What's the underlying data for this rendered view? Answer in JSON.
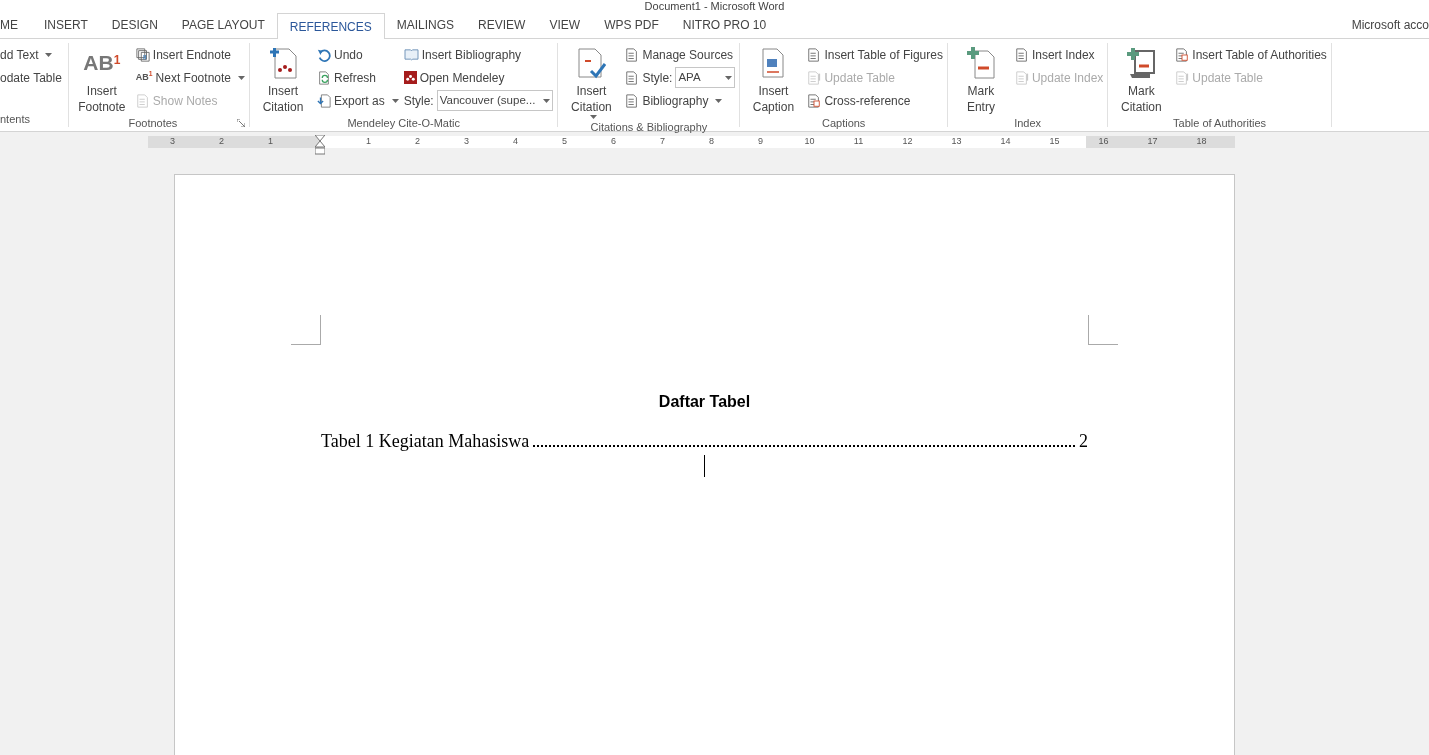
{
  "window": {
    "title": "Document1 - Microsoft Word"
  },
  "tabs": [
    {
      "label": "ME",
      "selected": false
    },
    {
      "label": "INSERT",
      "selected": false
    },
    {
      "label": "DESIGN",
      "selected": false
    },
    {
      "label": "PAGE LAYOUT",
      "selected": false
    },
    {
      "label": "REFERENCES",
      "selected": true
    },
    {
      "label": "MAILINGS",
      "selected": false
    },
    {
      "label": "REVIEW",
      "selected": false
    },
    {
      "label": "VIEW",
      "selected": false
    },
    {
      "label": "WPS PDF",
      "selected": false
    },
    {
      "label": "NITRO PRO 10",
      "selected": false
    }
  ],
  "account": "Microsoft acco",
  "groups": [
    {
      "label": "ntents",
      "columns": [
        [
          {
            "kind": "small",
            "label": "dd Text",
            "dropdown": true,
            "disabled": false
          },
          {
            "kind": "small",
            "label": "odate Table",
            "disabled": false
          }
        ]
      ]
    },
    {
      "label": "Footnotes",
      "launcher": true,
      "columns": [
        [
          {
            "kind": "large",
            "label": "Insert Footnote",
            "glyph": "AB$^{1}$",
            "disabled": false
          }
        ],
        [
          {
            "kind": "small",
            "label": "Insert Endnote",
            "disabled": false
          },
          {
            "kind": "small",
            "label": "Next Footnote",
            "glyph": "AB$^{1}$",
            "dropdown": true,
            "disabled": false
          },
          {
            "kind": "small",
            "label": "Show Notes",
            "disabled": true
          }
        ]
      ]
    },
    {
      "label": "Mendeley Cite-O-Matic",
      "columns": [
        [
          {
            "kind": "large",
            "label": "Insert Citation",
            "disabled": false
          }
        ],
        [
          {
            "kind": "small",
            "label": "Undo",
            "disabled": false
          },
          {
            "kind": "small",
            "label": "Refresh",
            "disabled": false
          },
          {
            "kind": "small",
            "label": "Export as",
            "dropdown": true,
            "disabled": false
          }
        ],
        [
          {
            "kind": "small",
            "label": "Insert Bibliography",
            "disabled": false
          },
          {
            "kind": "small",
            "label": "Open Mendeley",
            "disabled": false
          },
          {
            "kind": "select",
            "label": "Style:",
            "value": "Vancouver (supe..."
          }
        ]
      ]
    },
    {
      "label": "Citations & Bibliography",
      "columns": [
        [
          {
            "kind": "large",
            "label": "Insert Citation",
            "dropdown": true,
            "disabled": false
          }
        ],
        [
          {
            "kind": "small",
            "label": "Manage Sources",
            "disabled": false
          },
          {
            "kind": "select",
            "label": "Style:",
            "value": "APA"
          },
          {
            "kind": "small",
            "label": "Bibliography",
            "dropdown": true,
            "disabled": false
          }
        ]
      ]
    },
    {
      "label": "Captions",
      "columns": [
        [
          {
            "kind": "large",
            "label": "Insert Caption",
            "disabled": false
          }
        ],
        [
          {
            "kind": "small",
            "label": "Insert Table of Figures",
            "disabled": false
          },
          {
            "kind": "small",
            "label": "Update Table",
            "disabled": true
          },
          {
            "kind": "small",
            "label": "Cross-reference",
            "disabled": false
          }
        ]
      ]
    },
    {
      "label": "Index",
      "columns": [
        [
          {
            "kind": "large",
            "label": "Mark Entry",
            "disabled": false
          }
        ],
        [
          {
            "kind": "small",
            "label": "Insert Index",
            "disabled": false
          },
          {
            "kind": "small",
            "label": "Update Index",
            "disabled": true
          }
        ]
      ]
    },
    {
      "label": "Table of Authorities",
      "columns": [
        [
          {
            "kind": "large",
            "label": "Mark Citation",
            "disabled": false
          }
        ],
        [
          {
            "kind": "small",
            "label": "Insert Table of Authorities",
            "disabled": false
          },
          {
            "kind": "small",
            "label": "Update Table",
            "disabled": true
          }
        ]
      ]
    }
  ],
  "ruler": {
    "left_labels": [
      "3",
      "2",
      "1"
    ],
    "right_labels": [
      "1",
      "2",
      "3",
      "4",
      "5",
      "6",
      "7",
      "8",
      "9",
      "10",
      "11",
      "12",
      "13",
      "14",
      "15",
      "16",
      "17",
      "18"
    ]
  },
  "document": {
    "heading": "Daftar Tabel",
    "toc": [
      {
        "entry": "Tabel 1 Kegiatan Mahasiswa",
        "page": "2"
      }
    ]
  }
}
